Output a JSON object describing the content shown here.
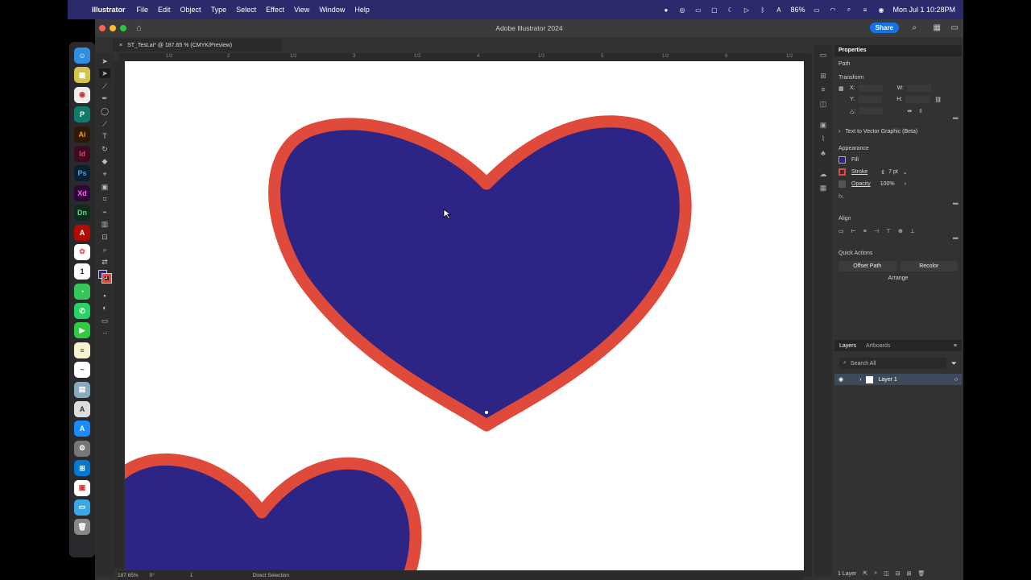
{
  "menubar": {
    "app_name": "Illustrator",
    "items": [
      "File",
      "Edit",
      "Object",
      "Type",
      "Select",
      "Effect",
      "View",
      "Window",
      "Help"
    ],
    "battery": "86%",
    "datetime": "Mon Jul 1  10:28PM"
  },
  "window": {
    "title": "Adobe Illustrator 2024",
    "share_label": "Share",
    "doc_tab": "ST_Test.ai* @ 187.65 % (CMYK/Preview)"
  },
  "ruler": {
    "top_labels": [
      "1/2",
      "2",
      "1/2",
      "3",
      "1/2",
      "4",
      "1/2",
      "5",
      "1/2",
      "6",
      "1/2"
    ]
  },
  "statusbar": {
    "zoom": "187.65%",
    "rotation": "0°",
    "artboard": "1",
    "tool": "Direct Selection"
  },
  "colors": {
    "fill": "#2c2585",
    "stroke": "#e04a3a",
    "accent": "#1473e6"
  },
  "properties": {
    "tab": "Properties",
    "object_type": "Path",
    "transform_title": "Transform",
    "x_label": "X:",
    "y_label": "Y:",
    "w_label": "W:",
    "h_label": "H:",
    "angle_label": "△:",
    "text_to_vector": "Text to Vector Graphic (Beta)",
    "appearance_title": "Appearance",
    "fill_label": "Fill",
    "stroke_label": "Stroke",
    "stroke_value": "7 pt",
    "opacity_label": "Opacity",
    "opacity_value": "100%",
    "fx_label": "fx.",
    "align_title": "Align",
    "quick_actions_title": "Quick Actions",
    "offset_path": "Offset Path",
    "recolor": "Recolor",
    "arrange": "Arrange"
  },
  "layers": {
    "tab_layers": "Layers",
    "tab_artboards": "Artboards",
    "search_placeholder": "Search All",
    "layer_name": "Layer 1",
    "count": "1 Layer"
  }
}
